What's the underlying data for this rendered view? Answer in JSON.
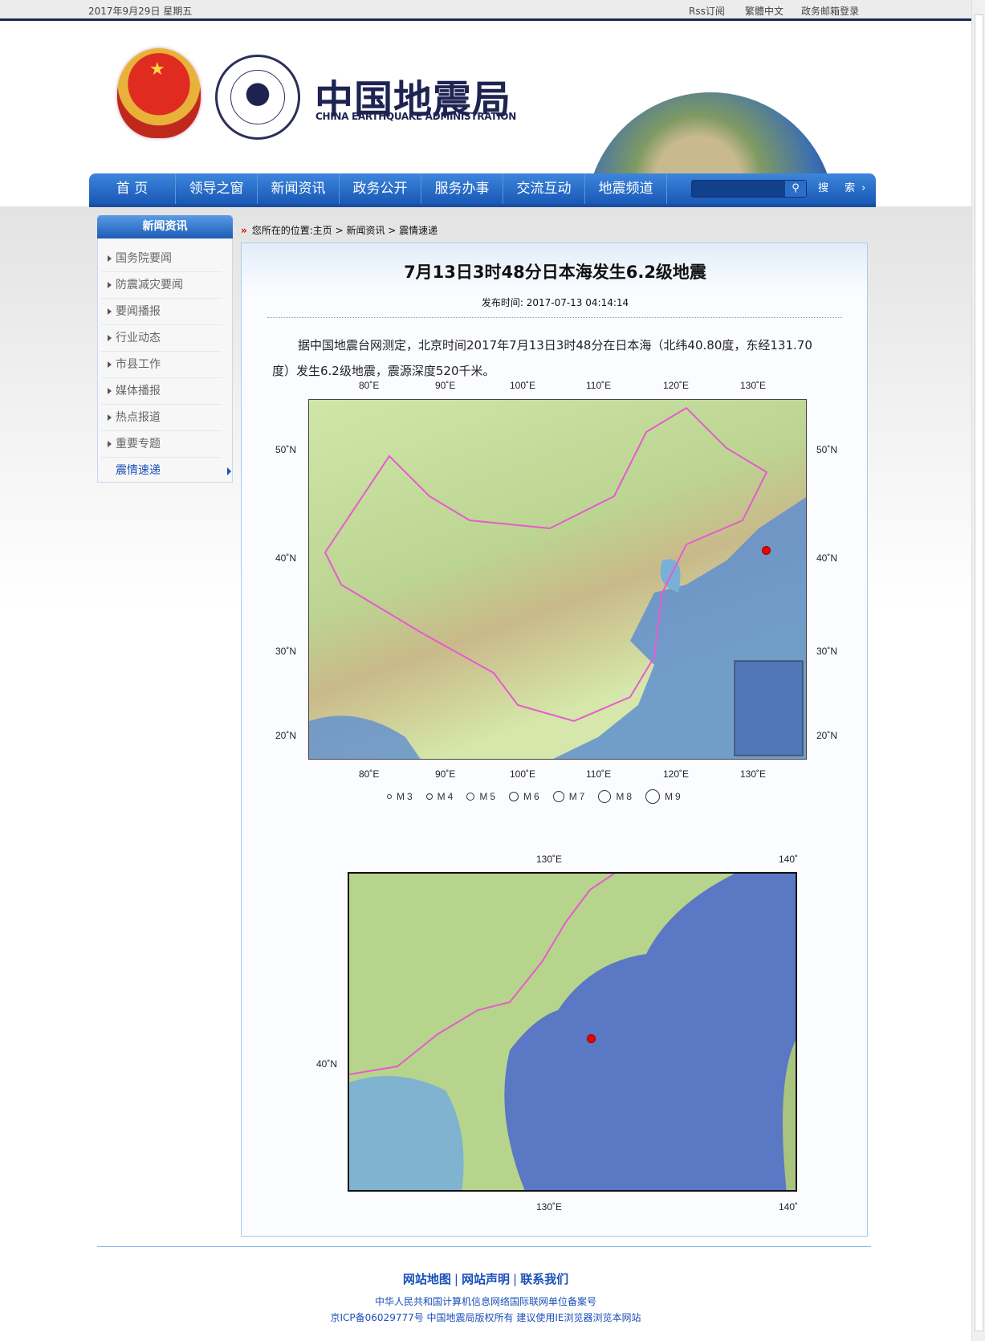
{
  "topbar": {
    "date": "2017年9月29日  星期五",
    "links": [
      "Rss订阅",
      "繁體中文",
      "政务邮箱登录"
    ]
  },
  "header": {
    "logo_cn": "中国地震局",
    "logo_en": "CHINA EARTHQUAKE ADMINISTRATION"
  },
  "nav": {
    "items": [
      "首 页",
      "领导之窗",
      "新闻资讯",
      "政务公开",
      "服务办事",
      "交流互动",
      "地震频道"
    ],
    "search_placeholder": "",
    "search_label": "搜 索›"
  },
  "sidebar": {
    "title": "新闻资讯",
    "items": [
      "国务院要闻",
      "防震减灾要闻",
      "要闻播报",
      "行业动态",
      "市县工作",
      "媒体播报",
      "热点报道",
      "重要专题",
      "震情速递"
    ],
    "active": "震情速递"
  },
  "breadcrumb": {
    "text": "您所在的位置:主页 > 新闻资讯 > 震情速递"
  },
  "article": {
    "title": "7月13日3时48分日本海发生6.2级地震",
    "pubdate": "发布时间: 2017-07-13 04:14:14",
    "para1": "据中国地震台网测定，北京时间2017年7月13日3时48分在日本海（北纬40.80度，东经131.70",
    "para2": "度）发生6.2级地震，震源深度520千米。"
  },
  "map1": {
    "lon_ticks": [
      "80˚E",
      "90˚E",
      "100˚E",
      "110˚E",
      "120˚E",
      "130˚E"
    ],
    "lat_ticks": [
      "50˚N",
      "40˚N",
      "30˚N",
      "20˚N"
    ],
    "legend": [
      "M3",
      "M4",
      "M5",
      "M6",
      "M7",
      "M8",
      "M9"
    ],
    "epicenter": {
      "lat": 40.8,
      "lon": 131.7
    }
  },
  "map2": {
    "lon_ticks": [
      "130˚E",
      "140˚"
    ],
    "lat_ticks": [
      "40˚N"
    ]
  },
  "footer": {
    "links": [
      "网站地图",
      "网站声明",
      "联系我们"
    ],
    "line1": "中华人民共和国计算机信息网络国际联网单位备案号",
    "line2": "京ICP备06029777号  中国地震局版权所有  建议使用IE浏览器浏览本网站"
  },
  "colors": {
    "nav": "#1d5cb6",
    "link": "#1a50b8",
    "quake": "#e00000"
  }
}
